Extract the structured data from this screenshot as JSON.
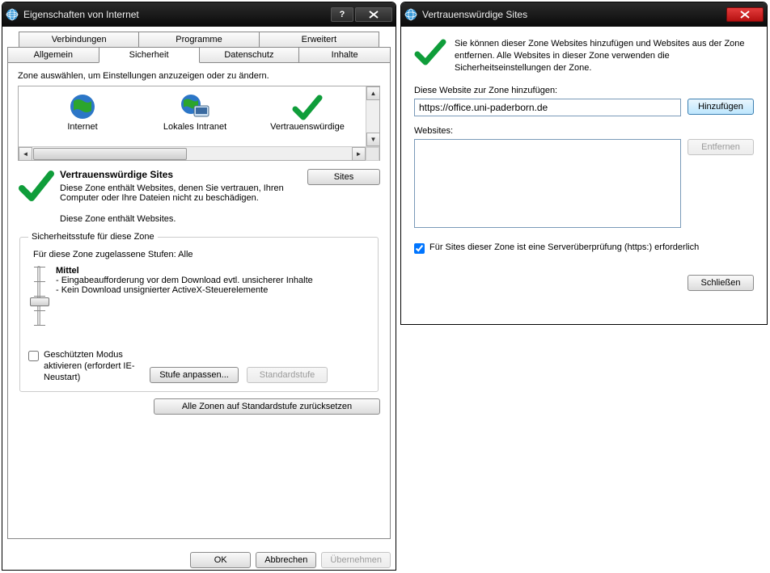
{
  "window1": {
    "title": "Eigenschaften von Internet",
    "tabs_top": [
      "Verbindungen",
      "Programme",
      "Erweitert"
    ],
    "tabs_bottom": [
      "Allgemein",
      "Sicherheit",
      "Datenschutz",
      "Inhalte"
    ],
    "active_tab": "Sicherheit",
    "zone_select_label": "Zone auswählen, um Einstellungen anzuzeigen oder zu ändern.",
    "zones": [
      {
        "label": "Internet"
      },
      {
        "label": "Lokales Intranet"
      },
      {
        "label": "Vertrauenswürdige"
      }
    ],
    "selected_zone_title": "Vertrauenswürdige Sites",
    "selected_zone_desc": "Diese Zone enthält Websites, denen Sie vertrauen, Ihren Computer oder Ihre Dateien nicht zu beschädigen.",
    "selected_zone_contains": "Diese Zone enthält Websites.",
    "sites_button": "Sites",
    "security_level_legend": "Sicherheitsstufe für diese Zone",
    "allowed_levels": "Für diese Zone zugelassene Stufen: Alle",
    "level_title": "Mittel",
    "level_line1": "- Eingabeaufforderung vor dem Download evtl. unsicherer Inhalte",
    "level_line2": "- Kein Download unsignierter ActiveX-Steuerelemente",
    "protected_mode_label": "Geschützten Modus aktivieren (erfordert IE-Neustart)",
    "protected_mode_checked": false,
    "custom_level_button": "Stufe anpassen...",
    "default_level_button": "Standardstufe",
    "reset_all_button": "Alle Zonen auf Standardstufe zurücksetzen",
    "ok_button": "OK",
    "cancel_button": "Abbrechen",
    "apply_button": "Übernehmen"
  },
  "window2": {
    "title": "Vertrauenswürdige Sites",
    "intro": "Sie können dieser Zone Websites hinzufügen und Websites aus der Zone entfernen. Alle Websites in dieser Zone verwenden die Sicherheitseinstellungen der Zone.",
    "add_label": "Diese Website zur Zone hinzufügen:",
    "add_value": "https://office.uni-paderborn.de",
    "add_button": "Hinzufügen",
    "websites_label": "Websites:",
    "remove_button": "Entfernen",
    "require_https_label": "Für Sites dieser Zone ist eine Serverüberprüfung (https:) erforderlich",
    "require_https_checked": true,
    "close_button": "Schließen"
  }
}
